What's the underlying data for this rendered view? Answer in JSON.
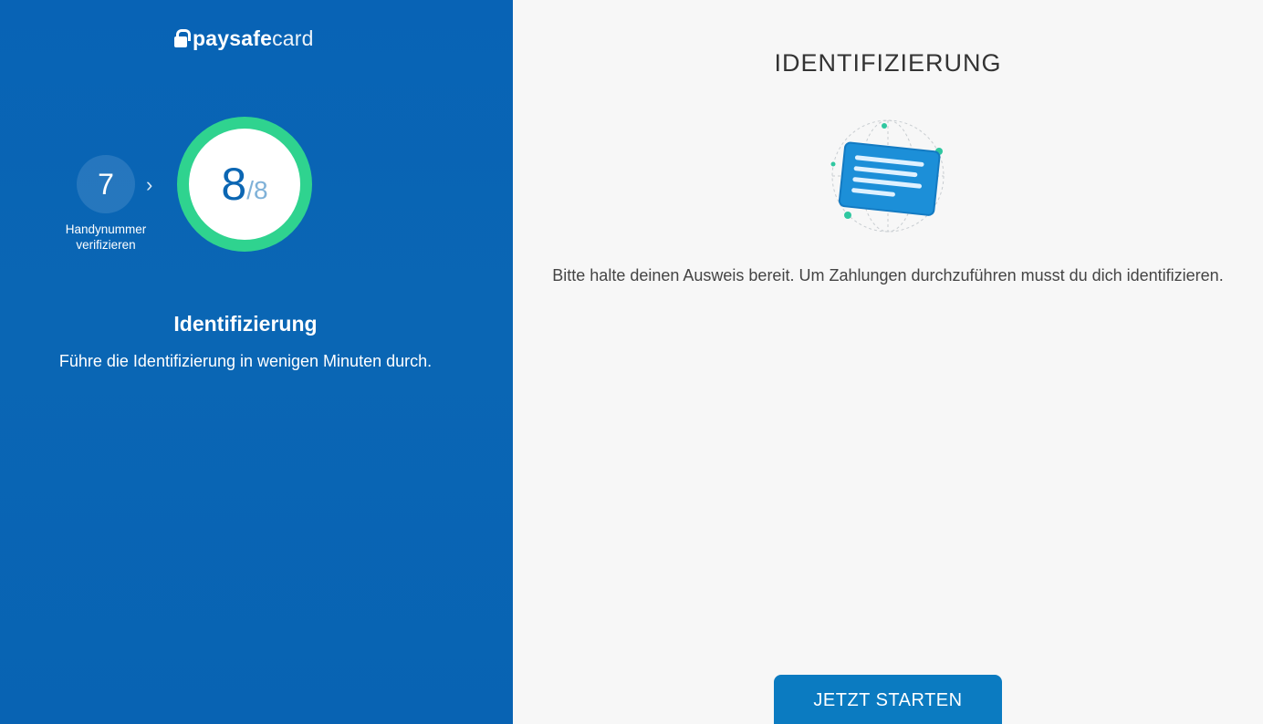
{
  "brand": {
    "bold": "paysafe",
    "thin": "card"
  },
  "steps": {
    "previous": {
      "number": "7",
      "label": "Handynummer verifizieren"
    },
    "current": {
      "number": "8",
      "total": "/8"
    }
  },
  "left": {
    "title": "Identifizierung",
    "subtitle": "Führe die Identifizierung in wenigen Minuten durch."
  },
  "right": {
    "title": "IDENTIFIZIERUNG",
    "text": "Bitte halte deinen Ausweis bereit. Um Zahlungen durchzuführen musst du dich identifizieren.",
    "button_label": "JETZT STARTEN",
    "illustration_icon": "id-card-icon"
  },
  "colors": {
    "left_background": "#0863b5",
    "progress_ring": "#2fd38f",
    "button": "#0b7bc1",
    "right_background": "#f7f7f7"
  }
}
